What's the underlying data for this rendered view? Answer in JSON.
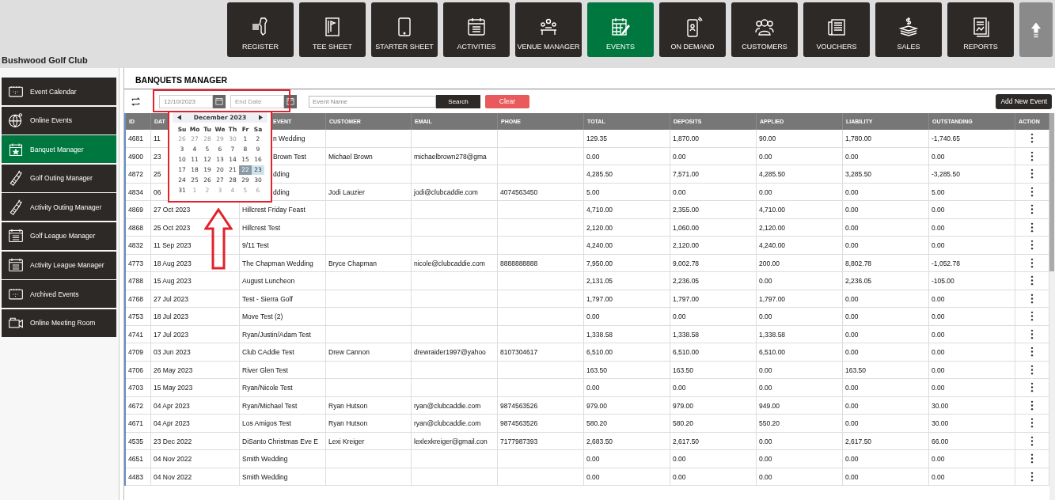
{
  "club_name": "Bushwood Golf Club",
  "nav": [
    {
      "label": "REGISTER",
      "selected": false
    },
    {
      "label": "TEE SHEET",
      "selected": false
    },
    {
      "label": "STARTER SHEET",
      "selected": false
    },
    {
      "label": "ACTIVITIES",
      "selected": false
    },
    {
      "label": "VENUE MANAGER",
      "selected": false
    },
    {
      "label": "EVENTS",
      "selected": true
    },
    {
      "label": "ON DEMAND",
      "selected": false
    },
    {
      "label": "CUSTOMERS",
      "selected": false
    },
    {
      "label": "VOUCHERS",
      "selected": false
    },
    {
      "label": "SALES",
      "selected": false
    },
    {
      "label": "REPORTS",
      "selected": false
    }
  ],
  "sidebar": {
    "items": [
      {
        "label": "Event Calendar",
        "selected": false
      },
      {
        "label": "Online Events",
        "selected": false
      },
      {
        "label": "Banquet Manager",
        "selected": true
      },
      {
        "label": "Golf Outing Manager",
        "selected": false
      },
      {
        "label": "Activity Outing Manager",
        "selected": false
      },
      {
        "label": "Golf League Manager",
        "selected": false
      },
      {
        "label": "Activity League Manager",
        "selected": false
      },
      {
        "label": "Archived Events",
        "selected": false
      },
      {
        "label": "Online Meeting Room",
        "selected": false
      }
    ]
  },
  "page_title": "BANQUETS MANAGER",
  "filters": {
    "start_date": {
      "value": "12/10/2023"
    },
    "end_date": {
      "placeholder": "End Date"
    },
    "event_name": {
      "placeholder": "Event Name"
    },
    "search_button": "Search",
    "clear_button": "Clear",
    "add_button": "Add New Event"
  },
  "date_picker": {
    "month": "December 2023",
    "weekdays": [
      "Su",
      "Mo",
      "Tu",
      "We",
      "Th",
      "Fr",
      "Sa"
    ],
    "weeks": [
      [
        {
          "d": "26",
          "muted": true,
          "selected": false,
          "highlighted": false
        },
        {
          "d": "27",
          "muted": true,
          "selected": false,
          "highlighted": false
        },
        {
          "d": "28",
          "muted": true,
          "selected": false,
          "highlighted": false
        },
        {
          "d": "29",
          "muted": true,
          "selected": false,
          "highlighted": false
        },
        {
          "d": "30",
          "muted": true,
          "selected": false,
          "highlighted": false
        },
        {
          "d": "1",
          "muted": false,
          "selected": false,
          "highlighted": false
        },
        {
          "d": "2",
          "muted": false,
          "selected": false,
          "highlighted": false
        }
      ],
      [
        {
          "d": "3",
          "muted": false,
          "selected": false,
          "highlighted": false
        },
        {
          "d": "4",
          "muted": false,
          "selected": false,
          "highlighted": false
        },
        {
          "d": "5",
          "muted": false,
          "selected": false,
          "highlighted": false
        },
        {
          "d": "6",
          "muted": false,
          "selected": false,
          "highlighted": false
        },
        {
          "d": "7",
          "muted": false,
          "selected": false,
          "highlighted": false
        },
        {
          "d": "8",
          "muted": false,
          "selected": false,
          "highlighted": false
        },
        {
          "d": "9",
          "muted": false,
          "selected": false,
          "highlighted": false
        }
      ],
      [
        {
          "d": "10",
          "muted": false,
          "selected": false,
          "highlighted": false
        },
        {
          "d": "11",
          "muted": false,
          "selected": false,
          "highlighted": false
        },
        {
          "d": "12",
          "muted": false,
          "selected": false,
          "highlighted": false
        },
        {
          "d": "13",
          "muted": false,
          "selected": false,
          "highlighted": false
        },
        {
          "d": "14",
          "muted": false,
          "selected": false,
          "highlighted": false
        },
        {
          "d": "15",
          "muted": false,
          "selected": false,
          "highlighted": false
        },
        {
          "d": "16",
          "muted": false,
          "selected": false,
          "highlighted": false
        }
      ],
      [
        {
          "d": "17",
          "muted": false,
          "selected": false,
          "highlighted": false
        },
        {
          "d": "18",
          "muted": false,
          "selected": false,
          "highlighted": false
        },
        {
          "d": "19",
          "muted": false,
          "selected": false,
          "highlighted": false
        },
        {
          "d": "20",
          "muted": false,
          "selected": false,
          "highlighted": false
        },
        {
          "d": "21",
          "muted": false,
          "selected": false,
          "highlighted": false
        },
        {
          "d": "22",
          "muted": false,
          "selected": true,
          "highlighted": true
        },
        {
          "d": "23",
          "muted": false,
          "selected": false,
          "highlighted": true
        }
      ],
      [
        {
          "d": "24",
          "muted": false,
          "selected": false,
          "highlighted": false
        },
        {
          "d": "25",
          "muted": false,
          "selected": false,
          "highlighted": false
        },
        {
          "d": "26",
          "muted": false,
          "selected": false,
          "highlighted": false
        },
        {
          "d": "27",
          "muted": false,
          "selected": false,
          "highlighted": false
        },
        {
          "d": "28",
          "muted": false,
          "selected": false,
          "highlighted": false
        },
        {
          "d": "29",
          "muted": false,
          "selected": false,
          "highlighted": false
        },
        {
          "d": "30",
          "muted": false,
          "selected": false,
          "highlighted": false
        }
      ],
      [
        {
          "d": "31",
          "muted": false,
          "selected": false,
          "highlighted": false
        },
        {
          "d": "1",
          "muted": true,
          "selected": false,
          "highlighted": false
        },
        {
          "d": "2",
          "muted": true,
          "selected": false,
          "highlighted": false
        },
        {
          "d": "3",
          "muted": true,
          "selected": false,
          "highlighted": false
        },
        {
          "d": "4",
          "muted": true,
          "selected": false,
          "highlighted": false
        },
        {
          "d": "5",
          "muted": true,
          "selected": false,
          "highlighted": false
        },
        {
          "d": "6",
          "muted": true,
          "selected": false,
          "highlighted": false
        }
      ]
    ]
  },
  "table": {
    "columns": [
      "ID",
      "DAT",
      "EVENT",
      "CUSTOMER",
      "EMAIL",
      "PHONE",
      "TOTAL",
      "DEPOSITS",
      "APPLIED",
      "LIABILITY",
      "OUTSTANDING",
      "ACTION"
    ],
    "rows": [
      [
        "4681",
        "11",
        "n Wedding",
        "",
        "",
        "",
        "129.35",
        "1,870.00",
        "90.00",
        "1,780.00",
        "-1,740.65"
      ],
      [
        "4900",
        "23",
        "Brown Test",
        "Michael Brown",
        "michaelbrown278@gma",
        "",
        "0.00",
        "0.00",
        "0.00",
        "0.00",
        "0.00"
      ],
      [
        "4872",
        "25",
        "dding",
        "",
        "",
        "",
        "4,285.50",
        "7,571.00",
        "4,285.50",
        "3,285.50",
        "-3,285.50"
      ],
      [
        "4834",
        "06",
        "dding",
        "Jodi Lauzier",
        "jodi@clubcaddie.com",
        "4074563450",
        "5.00",
        "0.00",
        "0.00",
        "0.00",
        "5.00"
      ],
      [
        "4869",
        "27 Oct 2023",
        "Hillcrest Friday Feast",
        "",
        "",
        "",
        "4,710.00",
        "2,355.00",
        "4,710.00",
        "0.00",
        "0.00"
      ],
      [
        "4868",
        "25 Oct 2023",
        "Hillcrest Test",
        "",
        "",
        "",
        "2,120.00",
        "1,060.00",
        "2,120.00",
        "0.00",
        "0.00"
      ],
      [
        "4832",
        "11 Sep 2023",
        "9/11 Test",
        "",
        "",
        "",
        "4,240.00",
        "2,120.00",
        "4,240.00",
        "0.00",
        "0.00"
      ],
      [
        "4773",
        "18 Aug 2023",
        "The Chapman Wedding",
        "Bryce  Chapman",
        "nicole@clubcaddie.com",
        "8888888888",
        "7,950.00",
        "9,002.78",
        "200.00",
        "8,802.78",
        "-1,052.78"
      ],
      [
        "4788",
        "15 Aug 2023",
        "August Luncheon",
        "",
        "",
        "",
        "2,131.05",
        "2,236.05",
        "0.00",
        "2,236.05",
        "-105.00"
      ],
      [
        "4768",
        "27 Jul 2023",
        "Test - Sierra Golf",
        "",
        "",
        "",
        "1,797.00",
        "1,797.00",
        "1,797.00",
        "0.00",
        "0.00"
      ],
      [
        "4753",
        "18 Jul 2023",
        "Move Test (2)",
        "",
        "",
        "",
        "0.00",
        "0.00",
        "0.00",
        "0.00",
        "0.00"
      ],
      [
        "4741",
        "17 Jul 2023",
        "Ryan/Justin/Adam Test",
        "",
        "",
        "",
        "1,338.58",
        "1,338.58",
        "1,338.58",
        "0.00",
        "0.00"
      ],
      [
        "4709",
        "03 Jun 2023",
        "Club CAddie Test",
        "Drew Cannon",
        "drewraider1997@yahoo",
        "8107304617",
        "6,510.00",
        "6,510.00",
        "6,510.00",
        "0.00",
        "0.00"
      ],
      [
        "4706",
        "26 May 2023",
        "River Glen Test",
        "",
        "",
        "",
        "163.50",
        "163.50",
        "0.00",
        "163.50",
        "0.00"
      ],
      [
        "4703",
        "15 May 2023",
        "Ryan/Nicole Test",
        "",
        "",
        "",
        "0.00",
        "0.00",
        "0.00",
        "0.00",
        "0.00"
      ],
      [
        "4672",
        "04 Apr 2023",
        "Ryan/Michael Test",
        "Ryan Hutson",
        "ryan@clubcaddie.com",
        "9874563526",
        "979.00",
        "979.00",
        "949.00",
        "0.00",
        "30.00"
      ],
      [
        "4671",
        "04 Apr 2023",
        "Los Amigos Test",
        "Ryan Hutson",
        "ryan@clubcaddie.com",
        "9874563526",
        "580.20",
        "580.20",
        "550.20",
        "0.00",
        "30.00"
      ],
      [
        "4535",
        "23 Dec 2022",
        "DiSanto Christmas Eve E",
        "Lexi Kreiger",
        "lexlexkreiger@gmail.con",
        "7177987393",
        "2,683.50",
        "2,617.50",
        "0.00",
        "2,617.50",
        "66.00"
      ],
      [
        "4651",
        "04 Nov 2022",
        "Smith Wedding",
        "",
        "",
        "",
        "0.00",
        "0.00",
        "0.00",
        "0.00",
        "0.00"
      ],
      [
        "4483",
        "04 Nov 2022",
        "Smith Wedding",
        "",
        "",
        "",
        "0.00",
        "0.00",
        "0.00",
        "0.00",
        "0.00"
      ]
    ]
  }
}
